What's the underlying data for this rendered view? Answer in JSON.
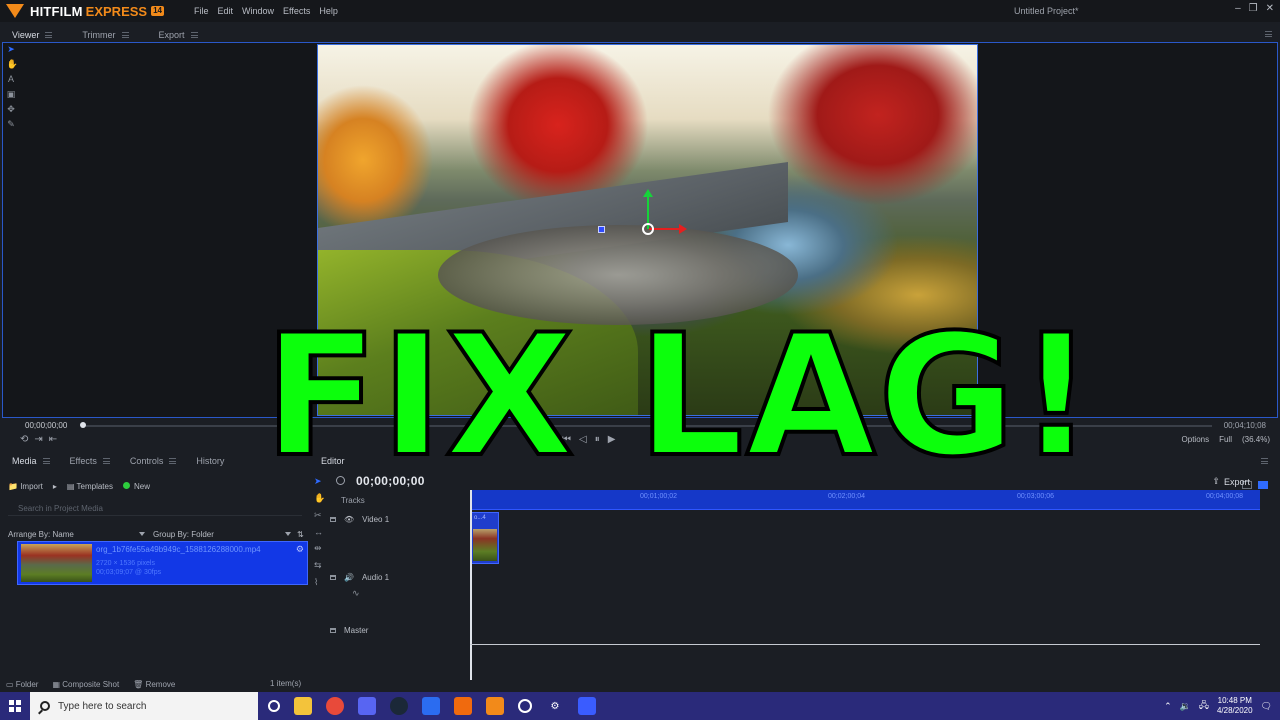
{
  "app": {
    "logo_primary": "HITFILM",
    "logo_secondary": "EXPRESS",
    "version_badge": "14",
    "project_title": "Untitled Project*",
    "menus": [
      "File",
      "Edit",
      "Window",
      "Effects",
      "Help"
    ]
  },
  "viewer": {
    "tabs": [
      "Viewer",
      "Trimmer",
      "Export"
    ],
    "current_time": "00;00;00;00",
    "end_time": "00;04;10;08",
    "options_label": "Options",
    "quality": "Full",
    "zoom": "(36.4%)"
  },
  "media_panel": {
    "tabs": [
      "Media",
      "Effects",
      "Controls",
      "History"
    ],
    "import_label": "Import",
    "templates_label": "Templates",
    "new_label": "New",
    "search_placeholder": "Search in Project Media",
    "arrange_by": "Arrange By: Name",
    "group_by": "Group By: Folder",
    "item": {
      "name": "org_1b76fe55a49b949c_1588126288000.mp4",
      "dimensions": "2720 × 1536 pixels",
      "duration": "00;03;09;07 @ 30fps"
    },
    "footer": {
      "folder": "Folder",
      "composite": "Composite Shot",
      "remove": "Remove",
      "count": "1 item(s)"
    }
  },
  "editor": {
    "tab": "Editor",
    "timecode": "00;00;00;00",
    "export_label": "Export",
    "tracks_label": "Tracks",
    "ruler_marks": [
      "00;01;00;02",
      "00;02;00;04",
      "00;03;00;06",
      "00;04;00;08"
    ],
    "tracks": [
      "Video 1",
      "Audio 1",
      "Master"
    ],
    "clip_label": "o...4"
  },
  "overlay": {
    "text": "FIX LAG!",
    "color": "#0cff0c"
  },
  "taskbar": {
    "search_placeholder": "Type here to search",
    "time": "10:48 PM",
    "date": "4/28/2020"
  },
  "colors": {
    "accent": "#2f6bff",
    "brand": "#f28a1a",
    "taskbar": "#2a2a7a"
  }
}
